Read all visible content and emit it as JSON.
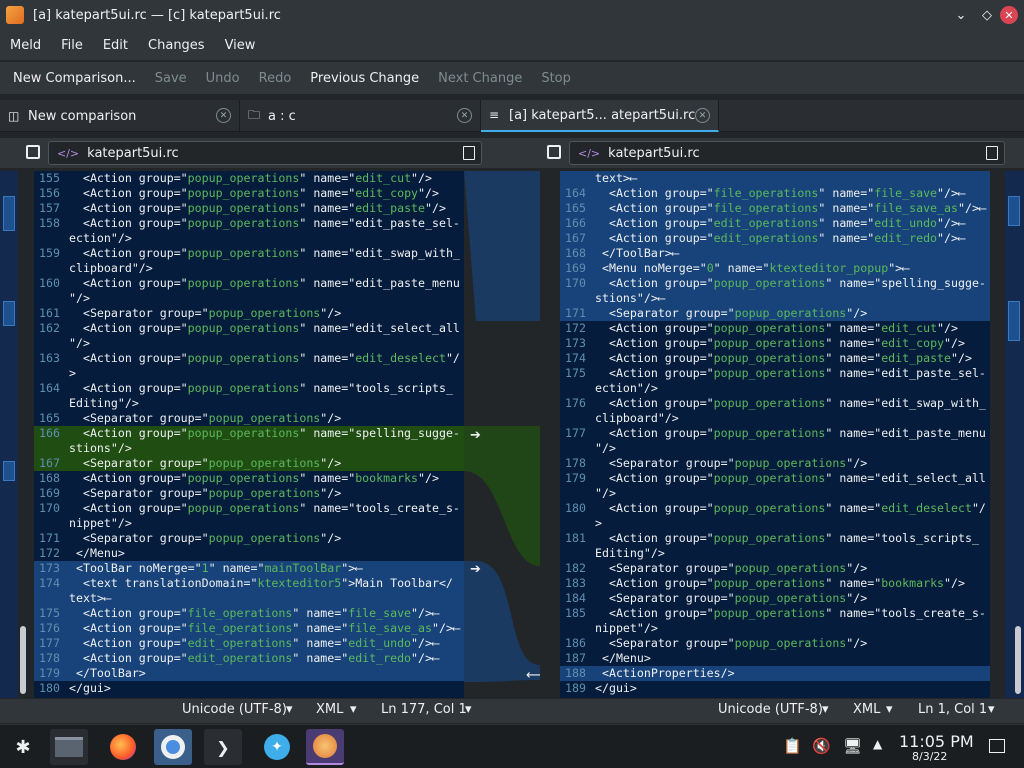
{
  "window": {
    "title": "[a] katepart5ui.rc — [c] katepart5ui.rc"
  },
  "menu": [
    "Meld",
    "File",
    "Edit",
    "Changes",
    "View"
  ],
  "toolbar": [
    {
      "label": "New Comparison...",
      "enabled": true
    },
    {
      "label": "Save",
      "enabled": false
    },
    {
      "label": "Undo",
      "enabled": false
    },
    {
      "label": "Redo",
      "enabled": false
    },
    {
      "label": "Previous Change",
      "enabled": true
    },
    {
      "label": "Next Change",
      "enabled": false
    },
    {
      "label": "Stop",
      "enabled": false
    }
  ],
  "tabs": [
    {
      "label": "New comparison",
      "icon": "file-icon"
    },
    {
      "label": "a : c",
      "icon": "folder-icon"
    },
    {
      "label": "[a] katepart5... atepart5ui.rc",
      "icon": "lines-icon",
      "active": true
    }
  ],
  "files": {
    "left": "katepart5ui.rc",
    "right": "katepart5ui.rc"
  },
  "left_lines": [
    {
      "n": "155",
      "t": "  <Action group=\"popup_operations\" name=\"edit_cut\"/>"
    },
    {
      "n": "156",
      "t": "  <Action group=\"popup_operations\" name=\"edit_copy\"/>"
    },
    {
      "n": "157",
      "t": "  <Action group=\"popup_operations\" name=\"edit_paste\"/>"
    },
    {
      "n": "158",
      "t": "  <Action group=\"popup_operations\" name=\"edit_paste_sel-"
    },
    {
      "n": "",
      "t": "ection\"/>"
    },
    {
      "n": "159",
      "t": "  <Action group=\"popup_operations\" name=\"edit_swap_with_"
    },
    {
      "n": "",
      "t": "clipboard\"/>"
    },
    {
      "n": "160",
      "t": "  <Action group=\"popup_operations\" name=\"edit_paste_menu"
    },
    {
      "n": "",
      "t": "\"/>"
    },
    {
      "n": "161",
      "t": "  <Separator group=\"popup_operations\"/>"
    },
    {
      "n": "162",
      "t": "  <Action group=\"popup_operations\" name=\"edit_select_all"
    },
    {
      "n": "",
      "t": "\"/>"
    },
    {
      "n": "163",
      "t": "  <Action group=\"popup_operations\" name=\"edit_deselect\"/"
    },
    {
      "n": "",
      "t": ">"
    },
    {
      "n": "164",
      "t": "  <Action group=\"popup_operations\" name=\"tools_scripts_"
    },
    {
      "n": "",
      "t": "Editing\"/>"
    },
    {
      "n": "165",
      "t": "  <Separator group=\"popup_operations\"/>"
    },
    {
      "n": "166",
      "t": "  <Action group=\"popup_operations\" name=\"spelling_sugge-",
      "hl": "green"
    },
    {
      "n": "",
      "t": "stions\"/>",
      "hl": "green"
    },
    {
      "n": "167",
      "t": "  <Separator group=\"popup_operations\"/>",
      "hl": "green"
    },
    {
      "n": "168",
      "t": "  <Action group=\"popup_operations\" name=\"bookmarks\"/>"
    },
    {
      "n": "169",
      "t": "  <Separator group=\"popup_operations\"/>"
    },
    {
      "n": "170",
      "t": "  <Action group=\"popup_operations\" name=\"tools_create_s-"
    },
    {
      "n": "",
      "t": "nippet\"/>"
    },
    {
      "n": "171",
      "t": "  <Separator group=\"popup_operations\"/>"
    },
    {
      "n": "172",
      "t": " </Menu>"
    },
    {
      "n": "173",
      "t": " <ToolBar noMerge=\"1\" name=\"mainToolBar\">⟵",
      "hl": "blue"
    },
    {
      "n": "174",
      "t": "  <text translationDomain=\"ktexteditor5\">Main Toolbar</",
      "hl": "blue"
    },
    {
      "n": "",
      "t": "text>⟵",
      "hl": "blue"
    },
    {
      "n": "175",
      "t": "  <Action group=\"file_operations\" name=\"file_save\"/>⟵",
      "hl": "blue"
    },
    {
      "n": "176",
      "t": "  <Action group=\"file_operations\" name=\"file_save_as\"/>⟵",
      "hl": "blue"
    },
    {
      "n": "177",
      "t": "  <Action group=\"edit_operations\" name=\"edit_undo\"/>⟵",
      "hl": "blue"
    },
    {
      "n": "178",
      "t": "  <Action group=\"edit_operations\" name=\"edit_redo\"/>⟵",
      "hl": "blue"
    },
    {
      "n": "179",
      "t": " </ToolBar>",
      "hl": "blue"
    },
    {
      "n": "180",
      "t": "</gui>"
    }
  ],
  "right_lines": [
    {
      "n": "",
      "t": "text>⟵",
      "hl": "blue"
    },
    {
      "n": "164",
      "t": "  <Action group=\"file_operations\" name=\"file_save\"/>⟵",
      "hl": "blue"
    },
    {
      "n": "165",
      "t": "  <Action group=\"file_operations\" name=\"file_save_as\"/>⟵",
      "hl": "blue"
    },
    {
      "n": "166",
      "t": "  <Action group=\"edit_operations\" name=\"edit_undo\"/>⟵",
      "hl": "blue"
    },
    {
      "n": "167",
      "t": "  <Action group=\"edit_operations\" name=\"edit_redo\"/>⟵",
      "hl": "blue"
    },
    {
      "n": "168",
      "t": " </ToolBar>⟵",
      "hl": "blue"
    },
    {
      "n": "169",
      "t": " <Menu noMerge=\"0\" name=\"ktexteditor_popup\">⟵",
      "hl": "blue"
    },
    {
      "n": "170",
      "t": "  <Action group=\"popup_operations\" name=\"spelling_sugge-",
      "hl": "blue"
    },
    {
      "n": "",
      "t": "stions\"/>⟵",
      "hl": "blue"
    },
    {
      "n": "171",
      "t": "  <Separator group=\"popup_operations\"/>",
      "hl": "blue"
    },
    {
      "n": "172",
      "t": "  <Action group=\"popup_operations\" name=\"edit_cut\"/>"
    },
    {
      "n": "173",
      "t": "  <Action group=\"popup_operations\" name=\"edit_copy\"/>"
    },
    {
      "n": "174",
      "t": "  <Action group=\"popup_operations\" name=\"edit_paste\"/>"
    },
    {
      "n": "175",
      "t": "  <Action group=\"popup_operations\" name=\"edit_paste_sel-"
    },
    {
      "n": "",
      "t": "ection\"/>"
    },
    {
      "n": "176",
      "t": "  <Action group=\"popup_operations\" name=\"edit_swap_with_"
    },
    {
      "n": "",
      "t": "clipboard\"/>"
    },
    {
      "n": "177",
      "t": "  <Action group=\"popup_operations\" name=\"edit_paste_menu"
    },
    {
      "n": "",
      "t": "\"/>"
    },
    {
      "n": "178",
      "t": "  <Separator group=\"popup_operations\"/>"
    },
    {
      "n": "179",
      "t": "  <Action group=\"popup_operations\" name=\"edit_select_all"
    },
    {
      "n": "",
      "t": "\"/>"
    },
    {
      "n": "180",
      "t": "  <Action group=\"popup_operations\" name=\"edit_deselect\"/"
    },
    {
      "n": "",
      "t": ">"
    },
    {
      "n": "181",
      "t": "  <Action group=\"popup_operations\" name=\"tools_scripts_"
    },
    {
      "n": "",
      "t": "Editing\"/>"
    },
    {
      "n": "182",
      "t": "  <Separator group=\"popup_operations\"/>"
    },
    {
      "n": "183",
      "t": "  <Action group=\"popup_operations\" name=\"bookmarks\"/>"
    },
    {
      "n": "184",
      "t": "  <Separator group=\"popup_operations\"/>"
    },
    {
      "n": "185",
      "t": "  <Action group=\"popup_operations\" name=\"tools_create_s-"
    },
    {
      "n": "",
      "t": "nippet\"/>"
    },
    {
      "n": "186",
      "t": "  <Separator group=\"popup_operations\"/>"
    },
    {
      "n": "187",
      "t": " </Menu>"
    },
    {
      "n": "188",
      "t": " <ActionProperties/>",
      "hl": "blue"
    },
    {
      "n": "189",
      "t": "</gui>"
    }
  ],
  "status_left": {
    "encoding": "Unicode (UTF-8)",
    "syntax": "XML",
    "position": "Ln 177, Col 1"
  },
  "status_right": {
    "encoding": "Unicode (UTF-8)",
    "syntax": "XML",
    "position": "Ln 1, Col 1"
  },
  "clock": {
    "time": "11:05 PM",
    "date": "8/3/22"
  },
  "colors": {
    "insert_blue": "#17437a",
    "change_green": "#1f4d12",
    "accent": "#3daee9"
  }
}
